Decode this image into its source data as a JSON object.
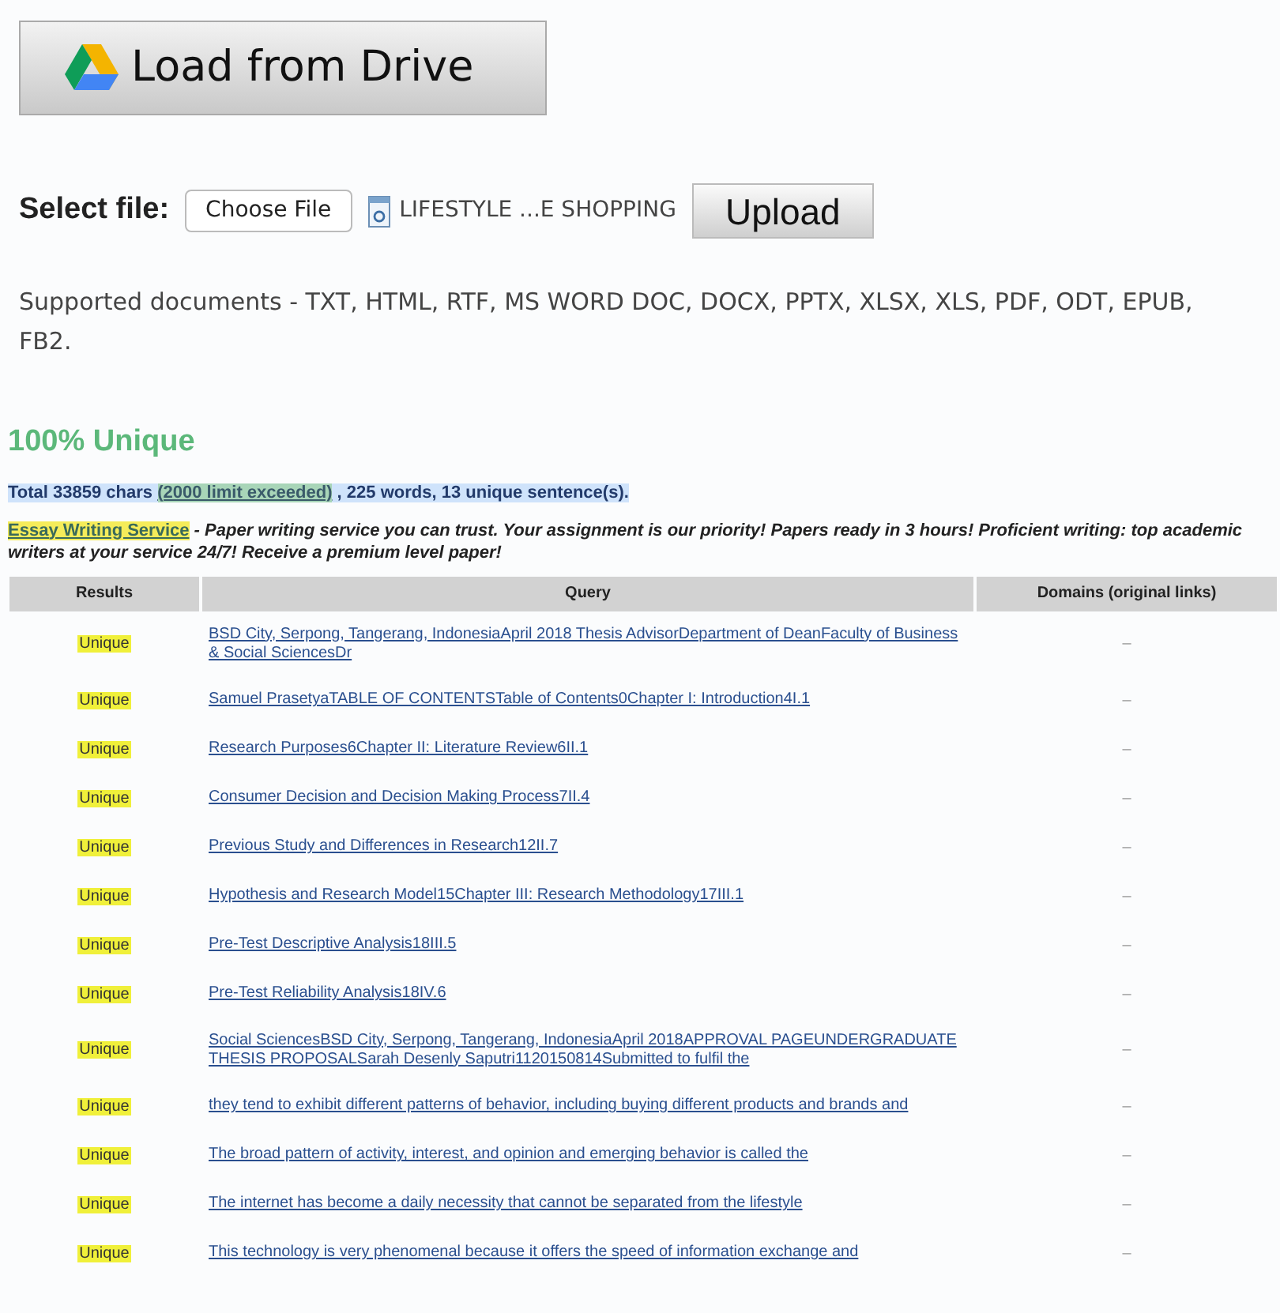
{
  "drive_button": {
    "label": "Load from Drive"
  },
  "upload_form": {
    "label": "Select file:",
    "choose_button": "Choose File",
    "file_name": "LIFESTYLE ...E SHOPPING",
    "upload_button": "Upload"
  },
  "supported_note": "Supported documents - TXT, HTML, RTF, MS WORD DOC, DOCX, PPTX, XLSX, XLS, PDF, ODT, EPUB, FB2.",
  "result": {
    "title": "100% Unique",
    "stats_prefix": "Total 33859 chars ",
    "stats_link": "(2000 limit exceeded)",
    "stats_suffix": " , 225 words, 13 unique sentence(s).",
    "ad_link": "Essay Writing Service",
    "ad_text": " - Paper writing service you can trust. Your assignment is our priority! Papers ready in 3 hours! Proficient writing: top academic writers at your service 24/7! Receive a premium level paper!"
  },
  "table": {
    "columns": [
      "Results",
      "Query",
      "Domains (original links)"
    ],
    "rows": [
      {
        "result": "Unique",
        "query": "BSD City, Serpong, Tangerang, IndonesiaApril 2018 Thesis AdvisorDepartment of DeanFaculty of Business & Social SciencesDr",
        "domains": "–"
      },
      {
        "result": "Unique",
        "query": "Samuel PrasetyaTABLE OF CONTENTSTable of Contents0Chapter I: Introduction4I.1",
        "domains": "–"
      },
      {
        "result": "Unique",
        "query": "Research Purposes6Chapter II: Literature Review6II.1",
        "domains": "–"
      },
      {
        "result": "Unique",
        "query": "Consumer Decision and Decision Making Process7II.4",
        "domains": "–"
      },
      {
        "result": "Unique",
        "query": "Previous Study and Differences in Research12II.7",
        "domains": "–"
      },
      {
        "result": "Unique",
        "query": "Hypothesis and Research Model15Chapter III: Research Methodology17III.1",
        "domains": "–"
      },
      {
        "result": "Unique",
        "query": "Pre-Test Descriptive Analysis18III.5",
        "domains": "–"
      },
      {
        "result": "Unique",
        "query": "Pre-Test Reliability Analysis18IV.6",
        "domains": "–"
      },
      {
        "result": "Unique",
        "query": "Social SciencesBSD City, Serpong, Tangerang, IndonesiaApril 2018APPROVAL PAGEUNDERGRADUATE THESIS PROPOSALSarah Desenly Saputri1120150814Submitted to fulfil the",
        "domains": "–"
      },
      {
        "result": "Unique",
        "query": "they tend to exhibit different patterns of behavior, including buying different products and brands and",
        "domains": "–"
      },
      {
        "result": "Unique",
        "query": "The broad pattern of activity, interest, and opinion and emerging behavior is called the",
        "domains": "–"
      },
      {
        "result": "Unique",
        "query": "The internet has become a daily necessity that cannot be separated from the lifestyle",
        "domains": "–"
      },
      {
        "result": "Unique",
        "query": "This technology is very phenomenal because it offers the speed of information exchange and",
        "domains": "–"
      }
    ]
  }
}
